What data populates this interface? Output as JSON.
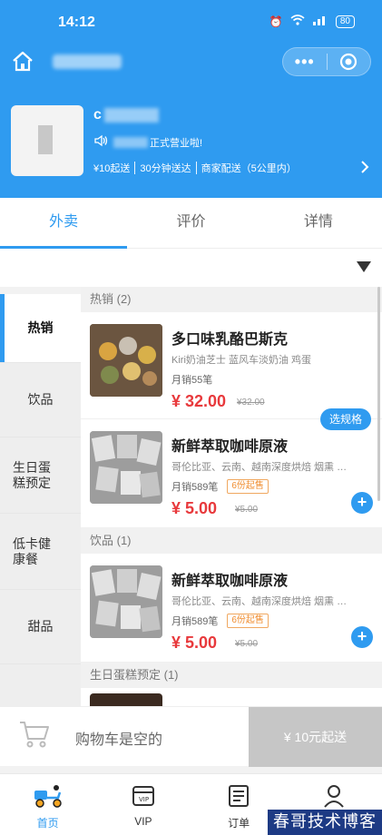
{
  "status": {
    "time": "14:12",
    "battery": "80"
  },
  "store": {
    "name_prefix": "c",
    "notice_suffix": "正式营业啦!",
    "info": [
      "¥10起送",
      "30分钟送达",
      "商家配送（5公里内）"
    ]
  },
  "tabs": [
    "外卖",
    "评价",
    "详情"
  ],
  "sidebar": [
    "热销",
    "饮品",
    "生日蛋糕预定",
    "低卡健康餐",
    "甜品"
  ],
  "menu": {
    "hot_header": "热销 (2)",
    "drinks_header": "饮品 (1)",
    "cake_header": "生日蛋糕预定 (1)",
    "items": [
      {
        "name": "多口味乳酪巴斯克",
        "desc": "Kiri奶油芝士 蓝风车淡奶油 鸡蛋",
        "sales": "月销55笔",
        "price": "¥ 32.00",
        "old_price": "¥32.00",
        "action": "选规格"
      },
      {
        "name": "新鲜萃取咖啡原液",
        "desc": "哥伦比亚、云南、越南深度烘焙 烟熏 焦...",
        "sales": "月销589笔",
        "min": "6份起售",
        "price": "¥ 5.00",
        "old_price": "¥5.00",
        "action": "+"
      },
      {
        "name": "新鲜萃取咖啡原液",
        "desc": "哥伦比亚、云南、越南深度烘焙 烟熏 焦...",
        "sales": "月销589笔",
        "min": "6份起售",
        "price": "¥ 5.00",
        "old_price": "¥5.00",
        "action": "+"
      }
    ]
  },
  "cart": {
    "empty_text": "购物车是空的",
    "checkout": "¥ 10元起送"
  },
  "nav": [
    "首页",
    "VIP",
    "订单",
    ""
  ],
  "watermark": "春哥技术博客",
  "colors": {
    "accent": "#2f9bf0",
    "price": "#e8393c"
  }
}
